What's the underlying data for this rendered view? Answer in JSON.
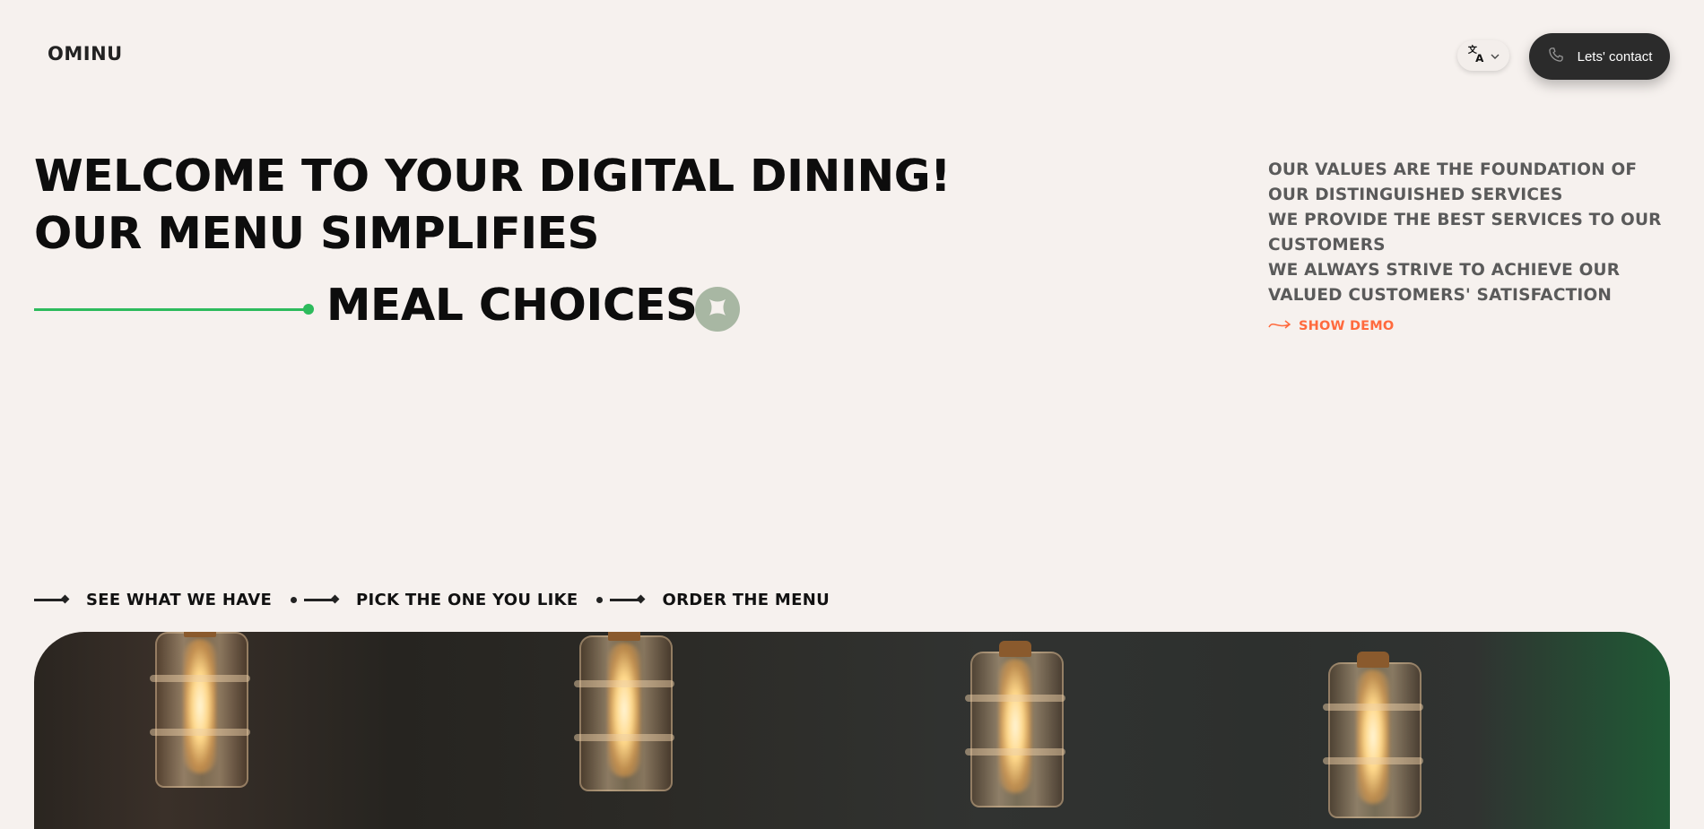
{
  "header": {
    "logo": "OMINU",
    "language_icon": "translate-icon",
    "contact_label": "Lets' contact",
    "contact_icon": "phone-icon"
  },
  "hero": {
    "line1": "WELCOME TO YOUR DIGITAL DINING!",
    "line2": "OUR MENU SIMPLIFIES",
    "line3": "MEAL CHOICES",
    "badge_icon": "sparkle-icon",
    "accent_color": "#2dbb5c"
  },
  "values": {
    "line1": "OUR VALUES ARE THE FOUNDATION OF OUR DISTINGUISHED SERVICES",
    "line2": "WE PROVIDE THE BEST SERVICES TO OUR CUSTOMERS",
    "line3": "WE ALWAYS STRIVE TO ACHIEVE OUR VALUED CUSTOMERS' SATISFACTION",
    "demo_label": "SHOW DEMO",
    "demo_icon": "arrow-right-icon",
    "demo_color": "#ff6a3d"
  },
  "steps": [
    {
      "label": "SEE WHAT WE HAVE"
    },
    {
      "label": "PICK THE ONE YOU LIKE"
    },
    {
      "label": "ORDER THE MENU"
    }
  ],
  "image": {
    "subject": "pendant-light-bulbs"
  }
}
